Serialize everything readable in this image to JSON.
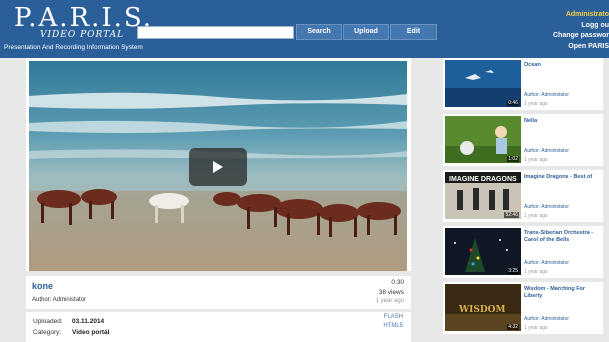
{
  "header": {
    "logo_title": "P.A.R.I.S.",
    "logo_subtitle": "VIDEO PORTAL",
    "logo_description": "Presentation And Recording Information System",
    "search_placeholder": "",
    "buttons": {
      "search": "Search",
      "upload": "Upload",
      "edit": "Edit"
    },
    "user_links": {
      "admin": "Administrato",
      "logout": "Logg ou",
      "change_password": "Change passwor",
      "open": "Open PARIS"
    }
  },
  "video": {
    "title": "kone",
    "author": "Author: Administator",
    "duration": "0:30",
    "views": "38 views",
    "age": "1 year ago"
  },
  "meta": {
    "uploaded_label": "Uploaded:",
    "uploaded_value": "03.11.2014",
    "category_label": "Category:",
    "category_value": "Video portál",
    "flash_link": "FLASH",
    "html5_link": "HTML5"
  },
  "sidebar": {
    "items": [
      {
        "title": "Ocean",
        "author": "Author: Administator",
        "age": "1 year ago",
        "duration": "0:46"
      },
      {
        "title": "Nella",
        "author": "Author: Administator",
        "age": "1 year ago",
        "duration": "1:02"
      },
      {
        "title": "Imagine Dragons - Best of",
        "author": "Author: Administator",
        "age": "1 year ago",
        "duration": "52:46"
      },
      {
        "title": "Trans-Siberian Orchestra - Carol of the Bells",
        "author": "Author: Administator",
        "age": "1 year ago",
        "duration": "3:25"
      },
      {
        "title": "Wisdom - Marching For Liberty",
        "author": "Author: Administator",
        "age": "1 year ago",
        "duration": "4:32"
      }
    ]
  },
  "colors": {
    "header_bg": "#2b5f9a",
    "accent": "#2b5f9a",
    "admin_link": "#f5d142"
  }
}
